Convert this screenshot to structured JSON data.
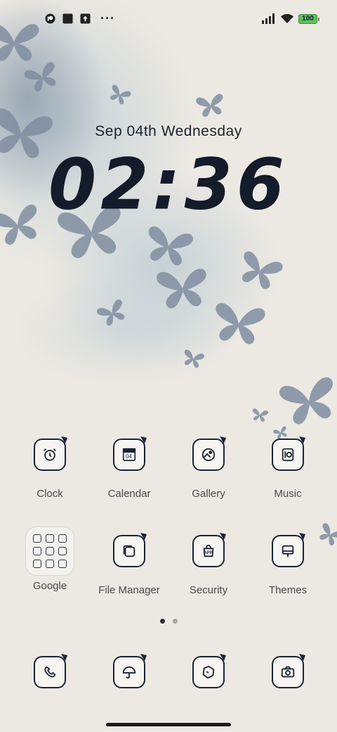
{
  "status_bar": {
    "overflow": "···",
    "battery": "100",
    "left_icons": [
      "vpn-icon",
      "square-app-icon",
      "upload-icon"
    ],
    "right_icons": [
      "signal-icon",
      "wifi-icon",
      "battery-icon"
    ]
  },
  "clock_widget": {
    "date": "Sep  04th  Wednesday",
    "time": "02:36"
  },
  "apps_row1": [
    {
      "label": "Clock",
      "icon": "alarm-clock-icon"
    },
    {
      "label": "Calendar",
      "icon": "calendar-icon"
    },
    {
      "label": "Gallery",
      "icon": "gallery-icon"
    },
    {
      "label": "Music",
      "icon": "music-icon"
    }
  ],
  "apps_row2": [
    {
      "label": "Google",
      "icon": "folder-icon"
    },
    {
      "label": "File Manager",
      "icon": "file-manager-icon"
    },
    {
      "label": "Security",
      "icon": "security-app-icon"
    },
    {
      "label": "Themes",
      "icon": "themes-icon"
    }
  ],
  "calendar_icon_day": "04",
  "security_icon_text": "APP",
  "dock": [
    {
      "icon": "phone-icon"
    },
    {
      "icon": "browser-icon"
    },
    {
      "icon": "messages-icon"
    },
    {
      "icon": "camera-icon"
    }
  ],
  "pager": {
    "pages": 2,
    "active": 0
  },
  "colors": {
    "icon_stroke": "#1b2436",
    "wallpaper_butterfly": "#7d8a9c",
    "background": "#ece9e3"
  }
}
